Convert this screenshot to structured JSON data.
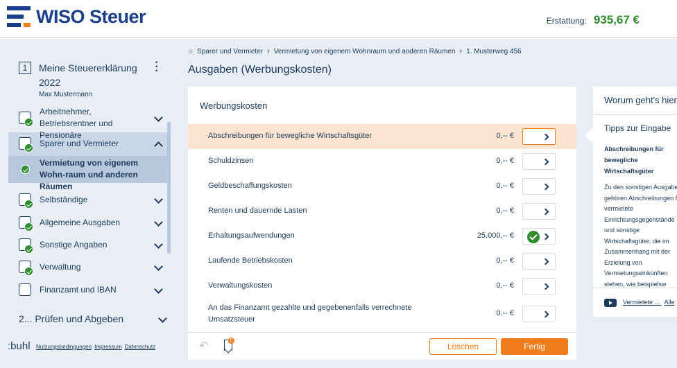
{
  "app": {
    "brand": "WISO Steuer",
    "refund_label": "Erstattung:",
    "refund_value": "935,67 €",
    "colors": {
      "brand_blue": "#1b3f8a",
      "accent_orange": "#f07d1b",
      "success_green": "#2e8b2e"
    }
  },
  "sidebar": {
    "step1_number": "1",
    "step1_title": "Meine Steuererklärung 2022",
    "user": "Max Mustermann",
    "items": [
      {
        "label": "Arbeitnehmer, Betriebsrentner und Pensionäre",
        "icon": "employee-icon"
      },
      {
        "label": "Sparer und Vermieter",
        "icon": "savings-icon"
      },
      {
        "label": "Vermietung von eigenem Wohn-raum und anderen Räumen",
        "icon": "check-icon"
      },
      {
        "label": "Selbständige",
        "icon": "self-employed-icon"
      },
      {
        "label": "Allgemeine Ausgaben",
        "icon": "expenses-icon"
      },
      {
        "label": "Sonstige Angaben",
        "icon": "clipboard-icon"
      },
      {
        "label": "Verwaltung",
        "icon": "documents-icon"
      },
      {
        "label": "Finanzamt und IBAN",
        "icon": "bank-icon"
      }
    ],
    "step2": "2... Prüfen und Abgeben",
    "footer_brand": ":buhl",
    "footer_links": [
      "Nutzungsbedingungen",
      "Impressum",
      "Datenschutz"
    ]
  },
  "breadcrumb": [
    "Sparer und Vermieter",
    "Vermietung von eigenem Wohnraum und anderen Räumen",
    "1. Musterweg 456"
  ],
  "page_title": "Ausgaben (Werbungskosten)",
  "panel": {
    "title": "Werbungskosten",
    "rows": [
      {
        "label": "Abschreibungen für bewegliche Wirtschaftsgüter",
        "value": "0,-- €",
        "done": false,
        "active": true
      },
      {
        "label": "Schuldzinsen",
        "value": "0,-- €",
        "done": false,
        "active": false
      },
      {
        "label": "Geldbeschaffungskosten",
        "value": "0,-- €",
        "done": false,
        "active": false
      },
      {
        "label": "Renten und dauernde Lasten",
        "value": "0,-- €",
        "done": false,
        "active": false
      },
      {
        "label": "Erhaltungsaufwendungen",
        "value": "25.000,-- €",
        "done": true,
        "active": false
      },
      {
        "label": "Laufende Betriebskosten",
        "value": "0,-- €",
        "done": false,
        "active": false
      },
      {
        "label": "Verwaltungskosten",
        "value": "0,-- €",
        "done": false,
        "active": false
      },
      {
        "label": "An das Finanzamt gezahlte und gegebenenfalls verrechnete Umsatzsteuer",
        "value": "0,-- €",
        "done": false,
        "active": false
      }
    ],
    "bookmark_count": "0",
    "delete_label": "Löschen",
    "next_label": "Fertig"
  },
  "tips": {
    "header": "Worum geht's hier",
    "subheader": "Tipps zur Eingabe",
    "bold_title": "Abschreibungen für bewegliche Wirtschaftsgüter",
    "body": "Zu den sonstigen Ausgaben gehören Abschreibungen für vermietete Einrichtungsgegenstände und sonstige Wirtschaftsgüter, die im Zusammenhang mit der Erzielung von Vermietungseinkünften stehen, wie beispielsw",
    "video_link": "Vermietete ...",
    "all_link": "Alle"
  }
}
